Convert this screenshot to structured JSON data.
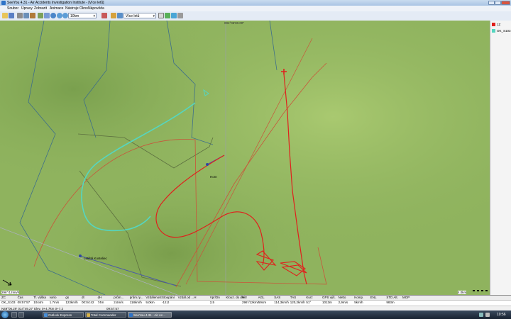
{
  "window": {
    "title": "SeeYou 4.31 - Air Accidents Investigation Institute - [Více letů]"
  },
  "menu": [
    "Soubor",
    "Úpravy",
    "Zobrazit",
    "Animace",
    "Nástroje",
    "Okno",
    "Nápověda"
  ],
  "toolbar": {
    "zoom_value": "10km",
    "flights_value": "Více letů"
  },
  "map": {
    "top_label": "004°06'00.00\"",
    "marker_label": "Horn",
    "waypoint_label": "Letiště Kosteliec",
    "scale_bottom_left": "296°/12km/h",
    "scale_bottom_right": "4.0km",
    "colors": {
      "terrain": "#8fb35e",
      "track_red": "#e0201c",
      "track_cyan": "#55d6c0",
      "airspace": "#c9553a"
    }
  },
  "legend": [
    {
      "name": "1Z",
      "color": "#e0201c"
    },
    {
      "name": "OK_S103",
      "color": "#55d6c0"
    }
  ],
  "table": {
    "headers": [
      "ZC",
      "Čas",
      "Tl. výška",
      "vario",
      "gs",
      "dt",
      "dH",
      "prům...",
      "prům.ry...",
      "Vzdálenost",
      "Stoupání",
      "Vzdál.od ...",
      "H",
      "Vpr/Dn",
      "Klouz. do dle",
      "Vítr",
      "AGL",
      "SAS",
      "TAS",
      "Kurz",
      "GPS výš.",
      "Netto",
      "Komp.",
      "ENL",
      "STD Alt.",
      "MOP"
    ],
    "row": [
      "OK_S103",
      "09:57:57",
      "1044m",
      "1.7m/s",
      "123km/h",
      "00:04:42",
      "74m",
      "2,6m/s",
      "118km/h",
      "9,0km",
      "-12,0",
      "",
      "",
      "2,5",
      "",
      "296°/12km/594m",
      "",
      "114,3km/h",
      "120,2km/h",
      "51°",
      "1013m",
      "2,9m/s",
      "5km/h",
      "",
      "983m",
      ""
    ],
    "status_left": "N49°06.29' 014°49.27' Elev. 0+4.7km 0+7.2",
    "status_right": "09:57:57"
  },
  "taskbar": {
    "items": [
      "Outlook Express",
      "Total Commander",
      "SeeYou 4.31 - Air Ac..."
    ],
    "clock": "10:56"
  }
}
